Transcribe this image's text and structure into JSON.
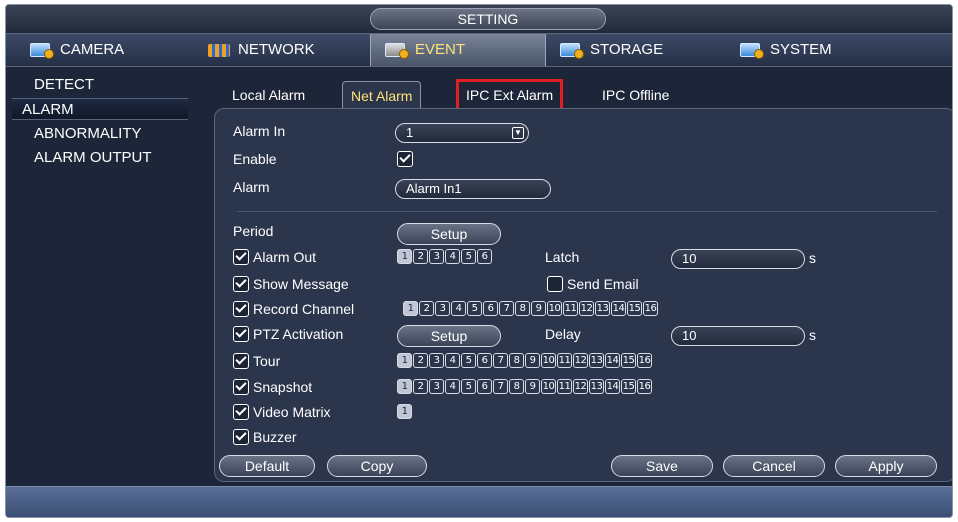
{
  "title": "SETTING",
  "top_tabs": [
    {
      "label": "CAMERA"
    },
    {
      "label": "NETWORK"
    },
    {
      "label": "EVENT"
    },
    {
      "label": "STORAGE"
    },
    {
      "label": "SYSTEM"
    }
  ],
  "sidebar": [
    {
      "label": "DETECT"
    },
    {
      "label": "ALARM"
    },
    {
      "label": "ABNORMALITY"
    },
    {
      "label": "ALARM OUTPUT"
    }
  ],
  "sub_tabs": [
    {
      "label": "Local Alarm"
    },
    {
      "label": "Net Alarm"
    },
    {
      "label": "IPC Ext Alarm"
    },
    {
      "label": "IPC Offline"
    }
  ],
  "form": {
    "alarm_in_label": "Alarm In",
    "alarm_in_value": "1",
    "enable_label": "Enable",
    "alarm_label": "Alarm",
    "alarm_value": "Alarm In1",
    "period_label": "Period",
    "setup_label": "Setup",
    "alarm_out_label": "Alarm Out",
    "alarm_out_channels": [
      "1",
      "2",
      "3",
      "4",
      "5",
      "6"
    ],
    "latch_label": "Latch",
    "latch_value": "10",
    "latch_unit": "s",
    "show_message_label": "Show Message",
    "send_email_label": "Send Email",
    "record_channel_label": "Record Channel",
    "channels16": [
      "1",
      "2",
      "3",
      "4",
      "5",
      "6",
      "7",
      "8",
      "9",
      "10",
      "11",
      "12",
      "13",
      "14",
      "15",
      "16"
    ],
    "ptz_label": "PTZ Activation",
    "ptz_setup_label": "Setup",
    "delay_label": "Delay",
    "delay_value": "10",
    "delay_unit": "s",
    "tour_label": "Tour",
    "snapshot_label": "Snapshot",
    "video_matrix_label": "Video Matrix",
    "video_matrix_channels": [
      "1"
    ],
    "buzzer_label": "Buzzer"
  },
  "buttons": {
    "default": "Default",
    "copy": "Copy",
    "save": "Save",
    "cancel": "Cancel",
    "apply": "Apply"
  },
  "colors": {
    "active_text": "#ffe27a",
    "highlight_box": "#e02020",
    "panel_bg": "#2b354c"
  }
}
